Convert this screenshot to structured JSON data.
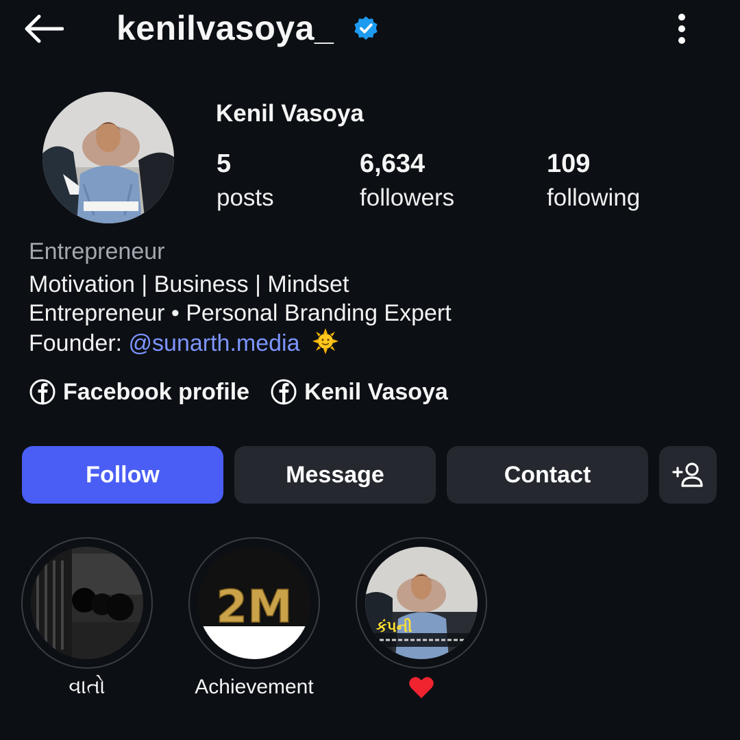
{
  "header": {
    "username": "kenilvasoya_",
    "verified": true,
    "icons": [
      "back-arrow-icon",
      "verified-badge-icon",
      "more-vertical-icon"
    ]
  },
  "profile": {
    "full_name": "Kenil Vasoya",
    "stats": {
      "posts": {
        "value": "5",
        "label": "posts"
      },
      "followers": {
        "value": "6,634",
        "label": "followers"
      },
      "following": {
        "value": "109",
        "label": "following"
      }
    }
  },
  "bio": {
    "category": "Entrepreneur",
    "line1": "Motivation | Business | Mindset",
    "line2": "Entrepreneur • Personal Branding Expert",
    "line3_prefix": "Founder: ",
    "mention": "@sunarth.media",
    "emoji": "🌞"
  },
  "links": [
    {
      "label": "Facebook profile",
      "icon": "facebook-icon"
    },
    {
      "label": "Kenil Vasoya",
      "icon": "facebook-icon"
    }
  ],
  "actions": {
    "follow": "Follow",
    "message": "Message",
    "contact": "Contact",
    "suggest_icon": "add-person-icon"
  },
  "highlights": [
    {
      "label": "વાતો"
    },
    {
      "label": "Achievement",
      "cover_text": "2M"
    },
    {
      "label": "❤️",
      "cover_text": "કંપની"
    }
  ],
  "colors": {
    "background": "#0c0f14",
    "follow_button": "#4a5ef5",
    "secondary_button": "#25282e",
    "mention": "#7d95ff",
    "verified": "#1d9bf0",
    "category_text": "#a4a8b0"
  }
}
